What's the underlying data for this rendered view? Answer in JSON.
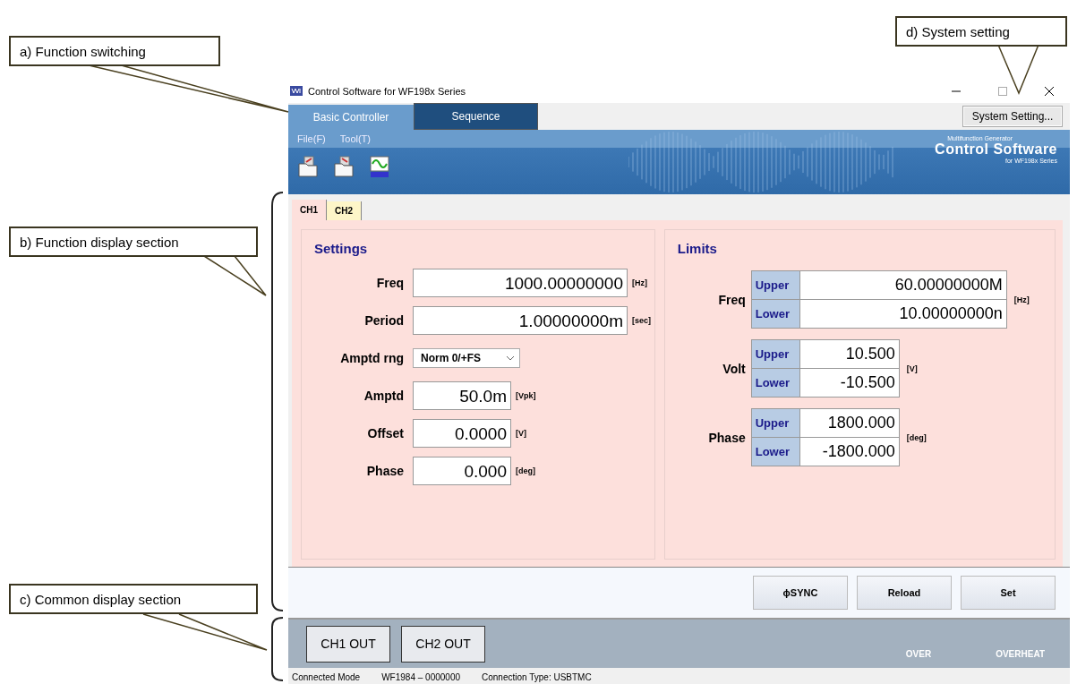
{
  "callouts": [
    {
      "text": "a) Function switching",
      "kind": "callout"
    },
    {
      "text": "b) Function display section",
      "kind": "callout"
    },
    {
      "text": "c) Common display section",
      "kind": "callout"
    },
    {
      "text": "d) System setting",
      "kind": "callout"
    }
  ],
  "window": {
    "title": "Control Software for WF198x Series"
  },
  "function_tabs": [
    {
      "label": "Basic Controller",
      "selected": true
    },
    {
      "label": "Sequence",
      "selected": false
    }
  ],
  "system_setting_button": "System Setting...",
  "menu": [
    "File(F)",
    "Tool(T)"
  ],
  "logo": {
    "subtitle": "Multifunction Generator",
    "title": "Control Software",
    "series": "for WF198x Series"
  },
  "channel_tabs": [
    {
      "label": "CH1",
      "selected": true
    },
    {
      "label": "CH2",
      "selected": false
    }
  ],
  "settings": {
    "title": "Settings",
    "fields": [
      {
        "label": "Freq",
        "value": "1000.00000000",
        "unit": "[Hz]",
        "kind": "input"
      },
      {
        "label": "Period",
        "value": "1.00000000m",
        "unit": "[sec]",
        "kind": "input"
      },
      {
        "label": "Amptd rng",
        "value": "Norm 0/+FS",
        "kind": "select"
      },
      {
        "label": "Amptd",
        "value": "50.0m",
        "unit": "[Vpk]",
        "kind": "input"
      },
      {
        "label": "Offset",
        "value": "0.0000",
        "unit": "[V]",
        "kind": "input"
      },
      {
        "label": "Phase",
        "value": "0.000",
        "unit": "[deg]",
        "kind": "input"
      }
    ]
  },
  "limits": {
    "title": "Limits",
    "groups": [
      {
        "label": "Freq",
        "unit": "[Hz]",
        "rows": [
          {
            "label": "Upper",
            "value": "60.00000000M"
          },
          {
            "label": "Lower",
            "value": "10.00000000n"
          }
        ]
      },
      {
        "label": "Volt",
        "unit": "[V]",
        "rows": [
          {
            "label": "Upper",
            "value": "10.500"
          },
          {
            "label": "Lower",
            "value": "-10.500"
          }
        ]
      },
      {
        "label": "Phase",
        "unit": "[deg]",
        "rows": [
          {
            "label": "Upper",
            "value": "1800.000"
          },
          {
            "label": "Lower",
            "value": "-1800.000"
          }
        ]
      }
    ]
  },
  "action_buttons": [
    "ϕSYNC",
    "Reload",
    "Set"
  ],
  "output_buttons": [
    "CH1 OUT",
    "CH2 OUT"
  ],
  "indicators": [
    {
      "label": "OVER",
      "on": false
    },
    {
      "label": "OVERHEAT",
      "on": false
    }
  ],
  "status_bar": [
    "Connected Mode",
    "WF1984  –  0000000",
    "Connection Type:  USBTMC"
  ]
}
